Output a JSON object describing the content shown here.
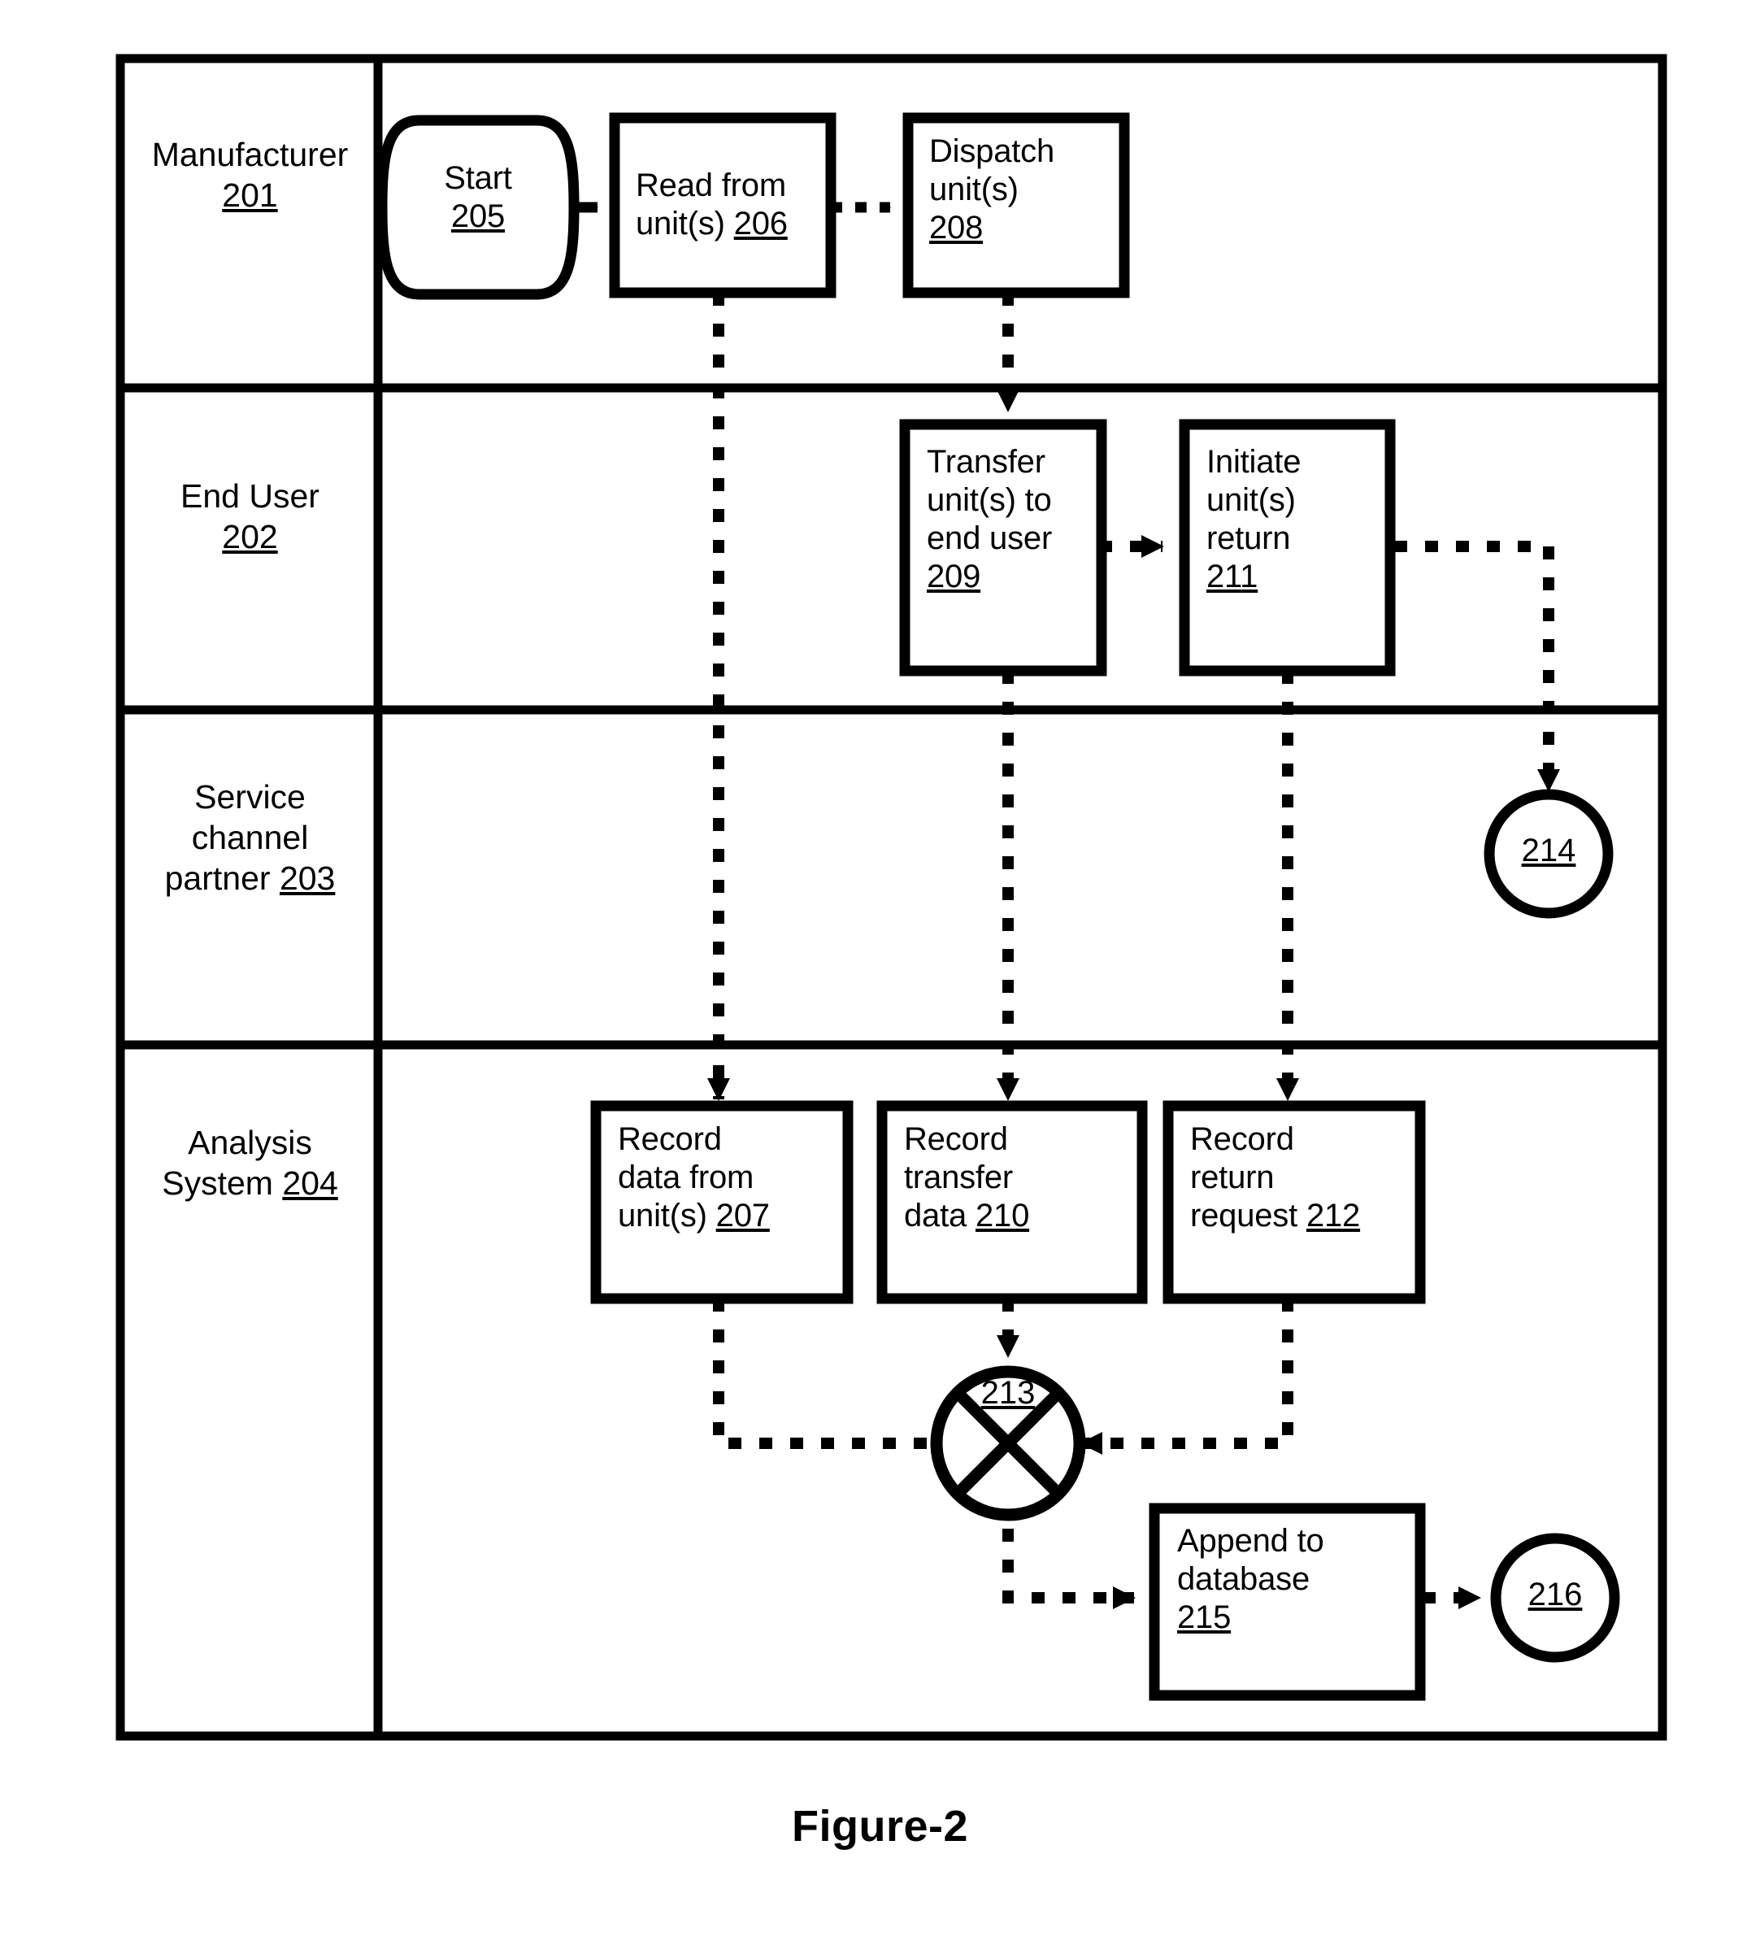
{
  "figure": {
    "caption": "Figure-2"
  },
  "swimlanes": [
    {
      "id": "manufacturer",
      "label": "Manufacturer",
      "ref": "201"
    },
    {
      "id": "end-user",
      "label": "End User",
      "ref": "202"
    },
    {
      "id": "service-channel-partner",
      "label_line1": "Service",
      "label_line2": "channel",
      "label_line3": "partner",
      "ref": "203"
    },
    {
      "id": "analysis-system",
      "label_line1": "Analysis",
      "label_line2": "System",
      "ref": "204"
    }
  ],
  "nodes": {
    "start": {
      "label": "Start",
      "ref": "205",
      "shape": "terminator"
    },
    "read_from_units": {
      "line1": "Read  from",
      "line2": "unit(s)",
      "ref": "206",
      "shape": "process"
    },
    "dispatch_units": {
      "line1": "Dispatch",
      "line2": "unit(s)",
      "ref": "208",
      "shape": "process"
    },
    "transfer_units": {
      "line1": "Transfer",
      "line2": "unit(s) to",
      "line3": "end user",
      "ref": "209",
      "shape": "process"
    },
    "initiate_return": {
      "line1": "Initiate",
      "line2": "unit(s)",
      "line3": "return",
      "ref": "211",
      "shape": "process"
    },
    "record_unit_data": {
      "line1": "Record",
      "line2": "data    from",
      "line3": "unit(s)",
      "ref": "207",
      "shape": "process"
    },
    "record_transfer_data": {
      "line1": "Record",
      "line2": "transfer",
      "line3": "data",
      "ref": "210",
      "shape": "process"
    },
    "record_return_request": {
      "line1": "Record",
      "line2": "return",
      "line3": "request",
      "ref": "212",
      "shape": "process"
    },
    "merge_junction": {
      "ref": "213",
      "shape": "cross-circle"
    },
    "append_to_database": {
      "line1": "Append    to",
      "line2": "database",
      "ref": "215",
      "shape": "process"
    },
    "connector_214": {
      "ref": "214",
      "shape": "connector"
    },
    "connector_216": {
      "ref": "216",
      "shape": "connector"
    }
  },
  "connections": [
    {
      "from": "start",
      "to": "read_from_units",
      "style": "solid-arrow"
    },
    {
      "from": "read_from_units",
      "to": "dispatch_units",
      "style": "dotted-arrow"
    },
    {
      "from": "read_from_units",
      "to": "record_unit_data",
      "style": "dotted-arrow"
    },
    {
      "from": "dispatch_units",
      "to": "transfer_units",
      "style": "dotted-arrow"
    },
    {
      "from": "transfer_units",
      "to": "initiate_return",
      "style": "dotted-arrow"
    },
    {
      "from": "transfer_units",
      "to": "record_transfer_data",
      "style": "dotted-arrow"
    },
    {
      "from": "initiate_return",
      "to": "connector_214",
      "style": "dotted-arrow"
    },
    {
      "from": "initiate_return",
      "to": "record_return_request",
      "style": "dotted-arrow"
    },
    {
      "from": "record_unit_data",
      "to": "merge_junction",
      "style": "dotted-arrow"
    },
    {
      "from": "record_transfer_data",
      "to": "merge_junction",
      "style": "dotted-arrow"
    },
    {
      "from": "record_return_request",
      "to": "merge_junction",
      "style": "dotted-arrow"
    },
    {
      "from": "merge_junction",
      "to": "append_to_database",
      "style": "dotted-arrow"
    },
    {
      "from": "append_to_database",
      "to": "connector_216",
      "style": "dotted-arrow"
    }
  ],
  "colors": {
    "stroke": "#000000",
    "background": "#ffffff",
    "text": "#000000"
  }
}
